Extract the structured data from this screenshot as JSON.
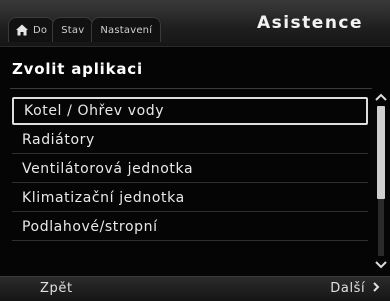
{
  "header": {
    "tabs": [
      {
        "label": "Do",
        "icon": "home-icon"
      },
      {
        "label": "Stav"
      },
      {
        "label": "Nastavení"
      }
    ],
    "title": "Asistence"
  },
  "main": {
    "heading": "Zvolit aplikaci",
    "items": [
      {
        "label": "Kotel / Ohřev vody"
      },
      {
        "label": "Radiátory"
      },
      {
        "label": "Ventilátorová jednotka"
      },
      {
        "label": "Klimatizační jednotka"
      },
      {
        "label": "Podlahové/stropní"
      }
    ],
    "scroll": {
      "up_icon": "chevron-up-icon",
      "down_icon": "chevron-down-icon",
      "position_fraction": 0.0,
      "visible_fraction": 0.62
    }
  },
  "footer": {
    "back_label": "Zpět",
    "next_label": "Další",
    "next_icon": "chevron-right-icon"
  },
  "colors": {
    "background": "#050505",
    "text": "#ffffff",
    "selection_border": "#dedede"
  }
}
